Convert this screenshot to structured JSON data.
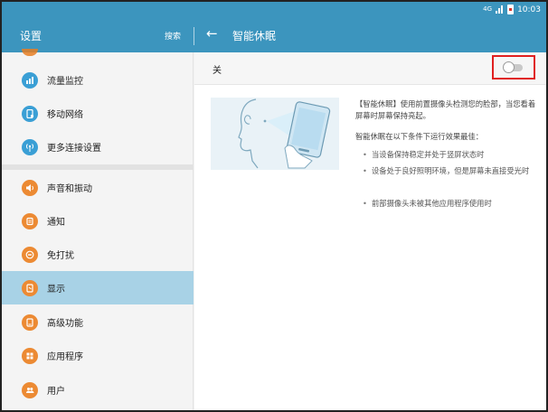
{
  "status_bar": {
    "signal": "4G",
    "time": "10:03"
  },
  "app_bar": {
    "left_title": "设置",
    "search_label": "搜索",
    "right_title": "智能休眠"
  },
  "sidebar": {
    "items": [
      {
        "label": "流量监控",
        "icon": "bar-chart-icon"
      },
      {
        "label": "移动网络",
        "icon": "mobile-network-icon"
      },
      {
        "label": "更多连接设置",
        "icon": "antenna-icon"
      },
      {
        "label": "声音和振动",
        "icon": "speaker-icon"
      },
      {
        "label": "通知",
        "icon": "bell-icon"
      },
      {
        "label": "免打扰",
        "icon": "do-not-disturb-icon"
      },
      {
        "label": "显示",
        "icon": "display-icon",
        "selected": true
      },
      {
        "label": "高级功能",
        "icon": "advanced-features-icon"
      },
      {
        "label": "应用程序",
        "icon": "apps-grid-icon"
      },
      {
        "label": "用户",
        "icon": "users-icon"
      }
    ]
  },
  "content": {
    "toggle_state_label": "关",
    "toggle_on": false,
    "description": "【智能休眠】使用前置摄像头检测您的脸部，当您看着屏幕时屏幕保持亮起。",
    "conditions_title": "智能休眠在以下条件下运行效果最佳：",
    "conditions": [
      "当设备保持稳定并处于竖屏状态时",
      "设备处于良好照明环境，但是屏幕未直接受光时",
      "前部摄像头未被其他应用程序使用时"
    ]
  },
  "colors": {
    "accent": "#3c95be",
    "selected_row": "#a8d2e6",
    "highlight_box": "#e02020",
    "icon_blue": "#3a9fd5",
    "icon_orange": "#ec8a33"
  }
}
